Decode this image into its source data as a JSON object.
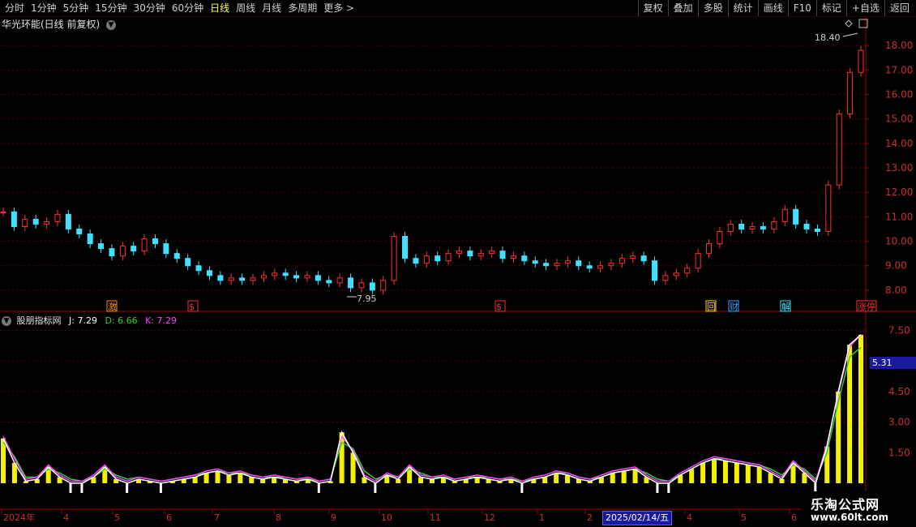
{
  "toolbar": {
    "periods": [
      "分时",
      "1分钟",
      "5分钟",
      "15分钟",
      "30分钟",
      "60分钟",
      "日线",
      "周线",
      "月线",
      "多周期",
      "更多 >"
    ],
    "active_period": "日线",
    "right_buttons": [
      "复权",
      "叠加",
      "多股",
      "统计",
      "画线",
      "F10",
      "标记",
      "+自选",
      "返回"
    ]
  },
  "stock": {
    "title": "华光环能(日线 前复权)"
  },
  "indicator": {
    "name": "股朋指标网",
    "j": "J: 7.29",
    "d": "D: 6.66",
    "k": "K: 7.29",
    "current_badge": "5.31",
    "colors": {
      "j": "#ffffff",
      "d": "#2fd02f",
      "k": "#ff44ff",
      "bar": "#ffff00"
    }
  },
  "price_axis": {
    "labels": [
      "18.00",
      "17.00",
      "16.00",
      "15.00",
      "14.00",
      "13.00",
      "12.00",
      "11.00",
      "10.00",
      "9.00",
      "8.00"
    ]
  },
  "indicator_axis": {
    "labels": [
      "7.50",
      "6.00",
      "4.50",
      "3.00",
      "1.50"
    ]
  },
  "annotations": {
    "high": "18.40",
    "low": "7.95"
  },
  "event_markers": [
    "激",
    "$",
    "$",
    "回",
    "财",
    "解",
    "涨停"
  ],
  "date_axis": {
    "labels": [
      "2024年",
      "4",
      "5",
      "6",
      "7",
      "8",
      "9",
      "10",
      "11",
      "12",
      "1",
      "2",
      "4",
      "5",
      "6"
    ],
    "highlight": "2025/02/14/五"
  },
  "watermark": {
    "line1": "乐淘公式网",
    "line2": "www.60lt.com"
  },
  "chart_data": [
    {
      "type": "candlestick",
      "title": "华光环能(日线 前复权)",
      "ylim": [
        7.6,
        18.6
      ],
      "close_series_approx": [
        11.2,
        10.6,
        10.9,
        10.7,
        10.8,
        11.1,
        10.5,
        10.3,
        9.9,
        9.7,
        9.4,
        9.8,
        9.6,
        10.1,
        9.9,
        9.5,
        9.3,
        9.0,
        8.8,
        8.6,
        8.4,
        8.5,
        8.4,
        8.5,
        8.6,
        8.7,
        8.6,
        8.5,
        8.6,
        8.4,
        8.3,
        8.5,
        8.1,
        8.3,
        8.0,
        8.4,
        10.2,
        9.3,
        9.1,
        9.4,
        9.2,
        9.5,
        9.6,
        9.4,
        9.5,
        9.6,
        9.3,
        9.4,
        9.2,
        9.1,
        9.0,
        9.1,
        9.2,
        9.0,
        8.9,
        9.0,
        9.1,
        9.3,
        9.4,
        9.2,
        8.4,
        8.6,
        8.7,
        8.9,
        9.5,
        9.9,
        10.4,
        10.7,
        10.5,
        10.6,
        10.5,
        10.8,
        11.3,
        10.7,
        10.5,
        10.4,
        12.3,
        15.2,
        16.9,
        17.8
      ]
    },
    {
      "type": "line",
      "title": "股朋指标网",
      "ylim": [
        0,
        7.8
      ],
      "series": [
        {
          "name": "J",
          "values": [
            2.2,
            1.0,
            0.1,
            0.2,
            0.8,
            0.3,
            0.0,
            0.0,
            0.3,
            0.8,
            0.2,
            0.0,
            0.2,
            0.1,
            0.0,
            0.1,
            0.2,
            0.3,
            0.5,
            0.6,
            0.4,
            0.5,
            0.3,
            0.2,
            0.3,
            0.2,
            0.1,
            0.2,
            0.0,
            0.1,
            2.5,
            1.5,
            0.3,
            0.0,
            0.4,
            0.2,
            0.8,
            0.3,
            0.2,
            0.3,
            0.1,
            0.2,
            0.3,
            0.2,
            0.1,
            0.2,
            0.0,
            0.2,
            0.3,
            0.5,
            0.4,
            0.2,
            0.1,
            0.3,
            0.5,
            0.6,
            0.7,
            0.3,
            0.0,
            0.0,
            0.4,
            0.7,
            1.0,
            1.2,
            1.1,
            1.0,
            0.9,
            0.8,
            0.5,
            0.2,
            1.0,
            0.5,
            0.0,
            1.8,
            4.5,
            6.8,
            7.29
          ]
        },
        {
          "name": "K",
          "values": [
            2.3,
            1.2,
            0.2,
            0.3,
            0.9,
            0.4,
            0.1,
            0.1,
            0.4,
            0.9,
            0.3,
            0.1,
            0.3,
            0.2,
            0.1,
            0.2,
            0.3,
            0.4,
            0.6,
            0.7,
            0.5,
            0.6,
            0.4,
            0.3,
            0.4,
            0.3,
            0.2,
            0.3,
            0.1,
            0.2,
            2.3,
            1.6,
            0.4,
            0.1,
            0.5,
            0.3,
            0.9,
            0.4,
            0.3,
            0.4,
            0.2,
            0.3,
            0.4,
            0.3,
            0.2,
            0.3,
            0.1,
            0.3,
            0.4,
            0.6,
            0.5,
            0.3,
            0.2,
            0.4,
            0.6,
            0.7,
            0.8,
            0.4,
            0.1,
            0.1,
            0.5,
            0.8,
            1.1,
            1.3,
            1.2,
            1.1,
            1.0,
            0.9,
            0.6,
            0.3,
            1.1,
            0.6,
            0.1,
            1.9,
            4.4,
            6.7,
            7.29
          ]
        },
        {
          "name": "D",
          "values": [
            2.0,
            1.3,
            0.3,
            0.3,
            0.7,
            0.5,
            0.2,
            0.1,
            0.3,
            0.7,
            0.4,
            0.2,
            0.3,
            0.2,
            0.1,
            0.2,
            0.3,
            0.4,
            0.5,
            0.6,
            0.5,
            0.5,
            0.4,
            0.3,
            0.3,
            0.3,
            0.2,
            0.2,
            0.1,
            0.2,
            2.0,
            1.7,
            0.6,
            0.2,
            0.4,
            0.3,
            0.7,
            0.5,
            0.3,
            0.3,
            0.2,
            0.3,
            0.3,
            0.3,
            0.2,
            0.2,
            0.1,
            0.2,
            0.3,
            0.5,
            0.5,
            0.3,
            0.2,
            0.3,
            0.5,
            0.6,
            0.7,
            0.5,
            0.2,
            0.1,
            0.4,
            0.7,
            1.0,
            1.2,
            1.2,
            1.1,
            1.0,
            0.9,
            0.7,
            0.4,
            0.9,
            0.7,
            0.2,
            1.5,
            4.0,
            6.2,
            6.66
          ]
        }
      ]
    }
  ]
}
